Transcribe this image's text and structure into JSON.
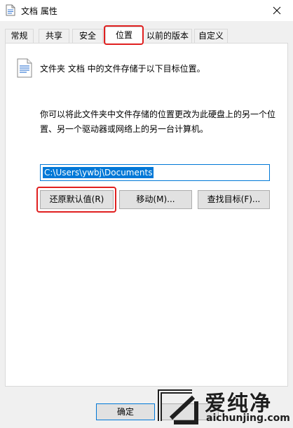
{
  "window": {
    "title": "文档 属性"
  },
  "tabs": [
    {
      "label": "常规"
    },
    {
      "label": "共享"
    },
    {
      "label": "安全"
    },
    {
      "label": "位置"
    },
    {
      "label": "以前的版本"
    },
    {
      "label": "自定义"
    }
  ],
  "active_tab": "位置",
  "location": {
    "info": "文件夹 文档 中的文件存储于以下目标位置。",
    "description": "你可以将此文件夹中文件存储的位置更改为此硬盘上的另一个位置、另一个驱动器或网络上的另一台计算机。",
    "path": "C:\\Users\\ywbj\\Documents",
    "restore_default_label": "还原默认值(R)",
    "move_label": "移动(M)...",
    "find_target_label": "查找目标(F)..."
  },
  "footer": {
    "ok_label": "确定"
  },
  "watermark": {
    "brand": "爱纯净",
    "url": "aichunjing.com"
  },
  "colors": {
    "highlight": "#e02020",
    "selection": "#0078d7"
  }
}
